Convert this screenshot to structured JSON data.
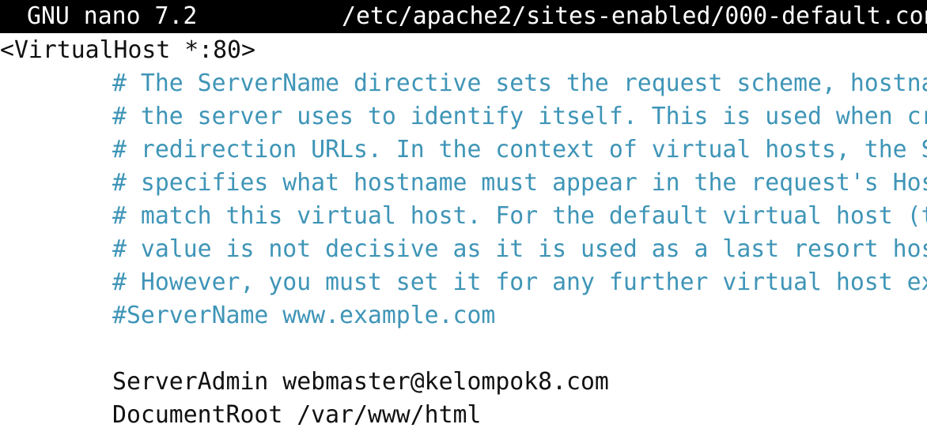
{
  "titlebar": {
    "app": "GNU nano 7.2",
    "path": "/etc/apache2/sites-enabled/000-default.con"
  },
  "editor": {
    "lines": [
      {
        "text": "<VirtualHost *:80>",
        "kind": "text"
      },
      {
        "text": "# The ServerName directive sets the request scheme, hostna",
        "kind": "comment"
      },
      {
        "text": "# the server uses to identify itself. This is used when cr",
        "kind": "comment"
      },
      {
        "text": "# redirection URLs. In the context of virtual hosts, the S",
        "kind": "comment"
      },
      {
        "text": "# specifies what hostname must appear in the request's Hos",
        "kind": "comment"
      },
      {
        "text": "# match this virtual host. For the default virtual host (t",
        "kind": "comment"
      },
      {
        "text": "# value is not decisive as it is used as a last resort hos",
        "kind": "comment"
      },
      {
        "text": "# However, you must set it for any further virtual host ex",
        "kind": "comment"
      },
      {
        "text": "#ServerName www.example.com",
        "kind": "comment"
      },
      {
        "text": "",
        "kind": "text"
      },
      {
        "text": "ServerAdmin webmaster@kelompok8.com",
        "kind": "text"
      },
      {
        "text": "DocumentRoot /var/www/html",
        "kind": "text"
      }
    ]
  },
  "colors": {
    "titlebar_bg": "#000000",
    "titlebar_fg": "#ffffff",
    "text": "#111111",
    "comment": "#3f95b7",
    "background": "#ffffff"
  }
}
